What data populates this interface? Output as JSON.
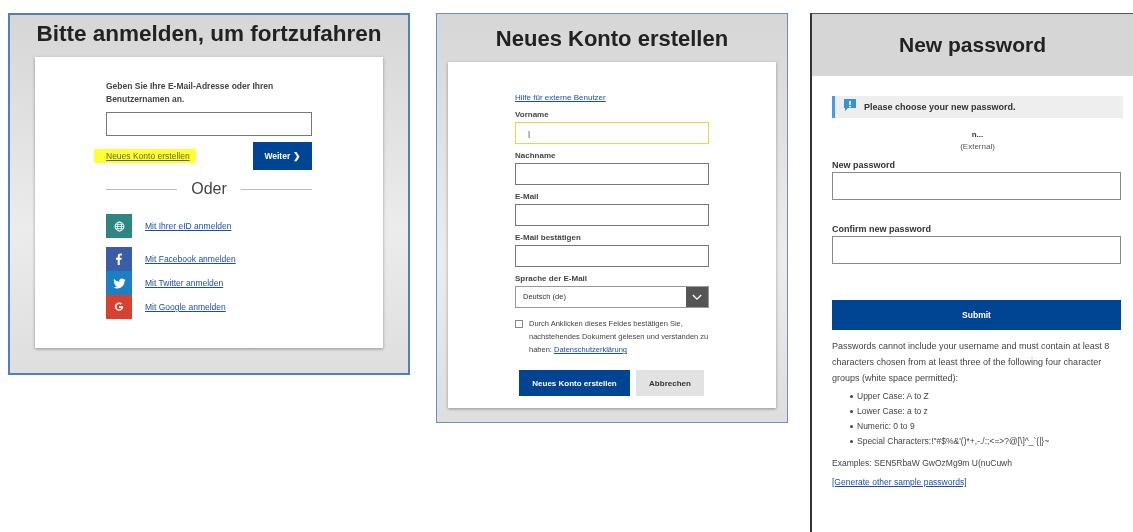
{
  "login": {
    "title": "Bitte anmelden, um fortzufahren",
    "prompt": "Geben Sie Ihre E-Mail-Adresse oder Ihren Benutzernamen an.",
    "create_link": {
      "label": "Neues Konto erstellen",
      "highlighted": true
    },
    "next_button": "Weiter ❯",
    "divider": "Oder",
    "providers": [
      {
        "kind": "eid",
        "label": "Mit Ihrer eID anmelden",
        "color": "#2e8682"
      },
      {
        "kind": "facebook",
        "label": "Mit Facebook anmelden",
        "color": "#3b5da8"
      },
      {
        "kind": "twitter",
        "label": "Mit Twitter anmelden",
        "color": "#1b7fc3"
      },
      {
        "kind": "google",
        "label": "Mit Google anmelden",
        "color": "#d8402f"
      }
    ]
  },
  "register": {
    "title": "Neues Konto erstellen",
    "help_link": "Hilfe für externe Benutzer",
    "fields": [
      {
        "label": "Vorname",
        "value": "|",
        "focused": true
      },
      {
        "label": "Nachname",
        "focused": false
      },
      {
        "label": "E-Mail",
        "focused": false
      },
      {
        "label": "E-Mail bestätigen",
        "focused": false
      }
    ],
    "language": {
      "label": "Sprache der E-Mail",
      "value": "Deutsch (de)"
    },
    "consent": {
      "checked": false,
      "text": "Durch Anklicken dieses Feldes bestätigen Sie, nachstehendes Dokument gelesen und verstanden zu haben:",
      "link": "Datenschutzerklärung"
    },
    "buttons": [
      {
        "kind": "primary",
        "label": "Neues Konto erstellen"
      },
      {
        "kind": "secondary",
        "label": "Abbrechen"
      }
    ]
  },
  "password": {
    "title": "New password",
    "notice": "Please choose your new password.",
    "user": "n...",
    "user_type": "(External)",
    "fields": [
      {
        "label": "New password"
      },
      {
        "label": "Confirm new password"
      }
    ],
    "submit": "Submit",
    "rules": "Passwords cannot include your username and must contain at least 8 characters chosen from at least three of the following four character groups (white space permitted):",
    "groups": [
      "Upper Case: A to Z",
      "Lower Case: a to z",
      "Numeric: 0 to 9",
      "Special Characters:!\"#$%&'()*+,-./:;<=>?@[\\]^_`{|}~"
    ],
    "examples": "Examples: SEN5RbaW GwOzMg9m U(nuCuwh",
    "generate_link": "[Generate other sample passwords]"
  }
}
